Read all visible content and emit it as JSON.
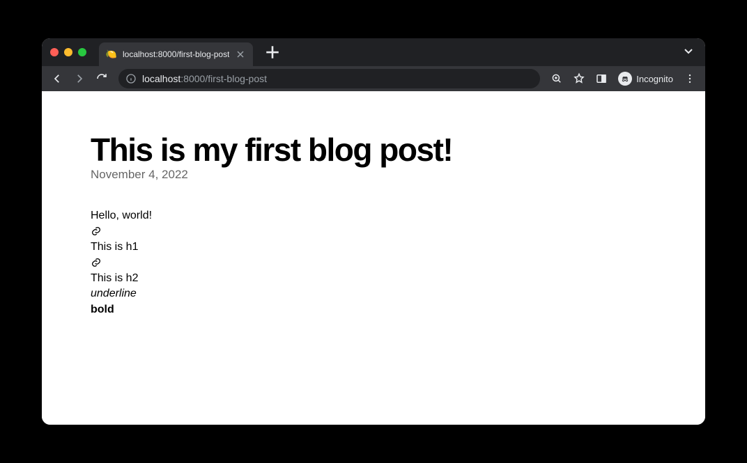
{
  "browser": {
    "tab": {
      "favicon": "🍋",
      "title": "localhost:8000/first-blog-post"
    },
    "url": {
      "host": "localhost",
      "port": ":8000",
      "path": "/first-blog-post"
    },
    "incognito_label": "Incognito"
  },
  "post": {
    "title": "This is my first blog post!",
    "date": "November 4, 2022",
    "lines": {
      "hello": "Hello, world!",
      "h1": "This is h1",
      "h2": "This is h2",
      "underline": "underline",
      "bold": "bold"
    }
  }
}
